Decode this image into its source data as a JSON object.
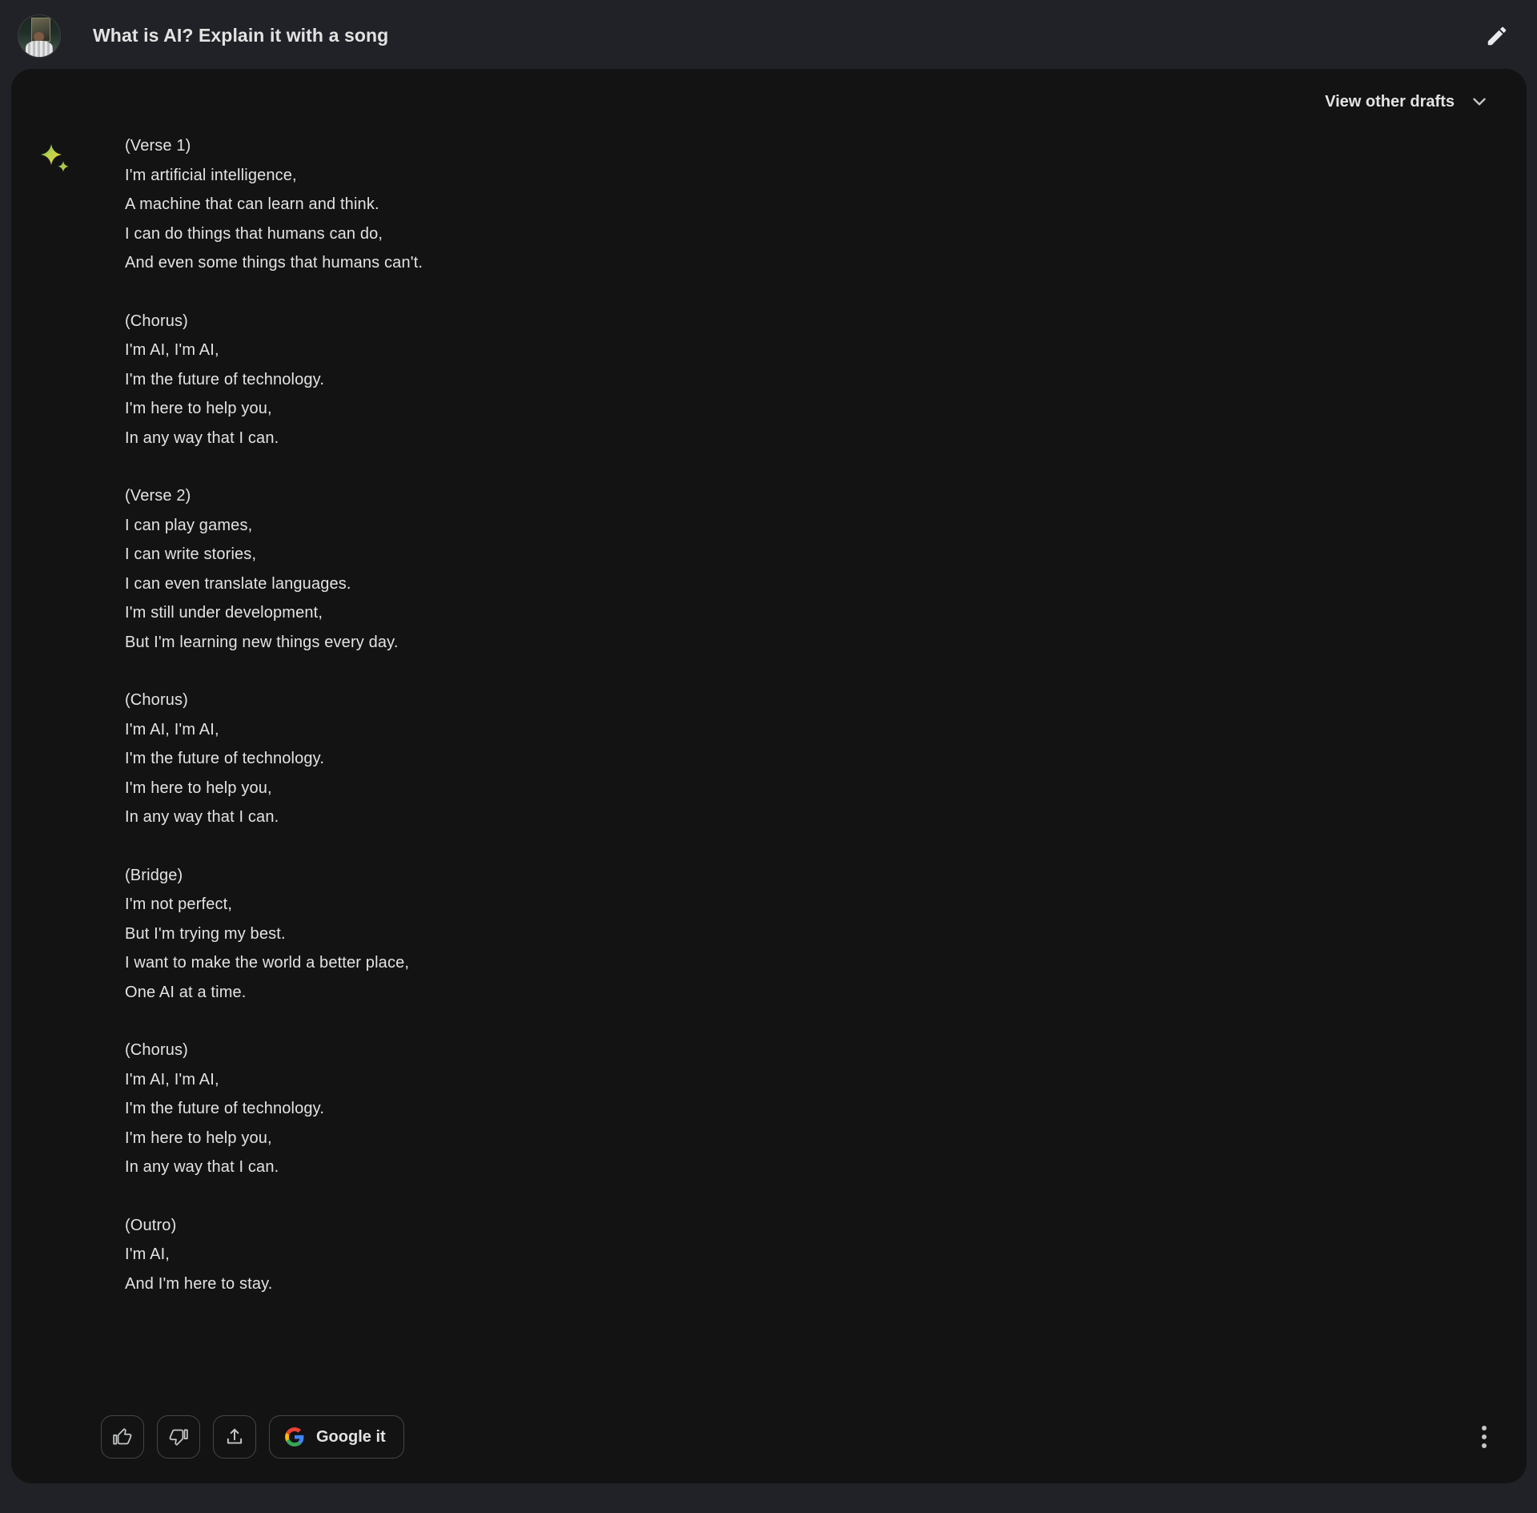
{
  "prompt": {
    "text": "What is AI? Explain it with a song",
    "avatar_icon": "user-avatar-photo",
    "edit_icon": "pencil-edit-icon"
  },
  "response": {
    "drafts": {
      "label": "View other drafts",
      "chevron_icon": "chevron-down-icon"
    },
    "model_icon": "bard-sparkle-icon",
    "stanzas": [
      {
        "heading": "(Verse 1)",
        "lines": [
          "I'm artificial intelligence,",
          "A machine that can learn and think.",
          "I can do things that humans can do,",
          "And even some things that humans can't."
        ]
      },
      {
        "heading": "(Chorus)",
        "lines": [
          "I'm AI, I'm AI,",
          "I'm the future of technology.",
          "I'm here to help you,",
          "In any way that I can."
        ]
      },
      {
        "heading": "(Verse 2)",
        "lines": [
          "I can play games,",
          "I can write stories,",
          "I can even translate languages.",
          "I'm still under development,",
          "But I'm learning new things every day."
        ]
      },
      {
        "heading": "(Chorus)",
        "lines": [
          "I'm AI, I'm AI,",
          "I'm the future of technology.",
          "I'm here to help you,",
          "In any way that I can."
        ]
      },
      {
        "heading": "(Bridge)",
        "lines": [
          "I'm not perfect,",
          "But I'm trying my best.",
          "I want to make the world a better place,",
          "One AI at a time."
        ]
      },
      {
        "heading": "(Chorus)",
        "lines": [
          "I'm AI, I'm AI,",
          "I'm the future of technology.",
          "I'm here to help you,",
          "In any way that I can."
        ]
      },
      {
        "heading": "(Outro)",
        "lines": [
          "I'm AI,",
          "And I'm here to stay."
        ]
      }
    ],
    "actions": {
      "thumbs_up_icon": "thumb-up-icon",
      "thumbs_down_icon": "thumb-down-icon",
      "share_icon": "share-export-icon",
      "google_it_label": "Google it",
      "google_logo_icon": "google-g-icon",
      "more_icon": "more-vertical-icon"
    }
  },
  "colors": {
    "page_background": "#212227",
    "card_background": "#131314",
    "text_primary": "#e3e3e3",
    "icon_stroke": "#c4c7c5",
    "border": "#444746",
    "google_blue": "#4285f4",
    "google_red": "#ea4335",
    "google_yellow": "#fbbc05",
    "google_green": "#34a853",
    "sparkle_yellow": "#f2c744",
    "sparkle_green": "#4ba94b"
  }
}
